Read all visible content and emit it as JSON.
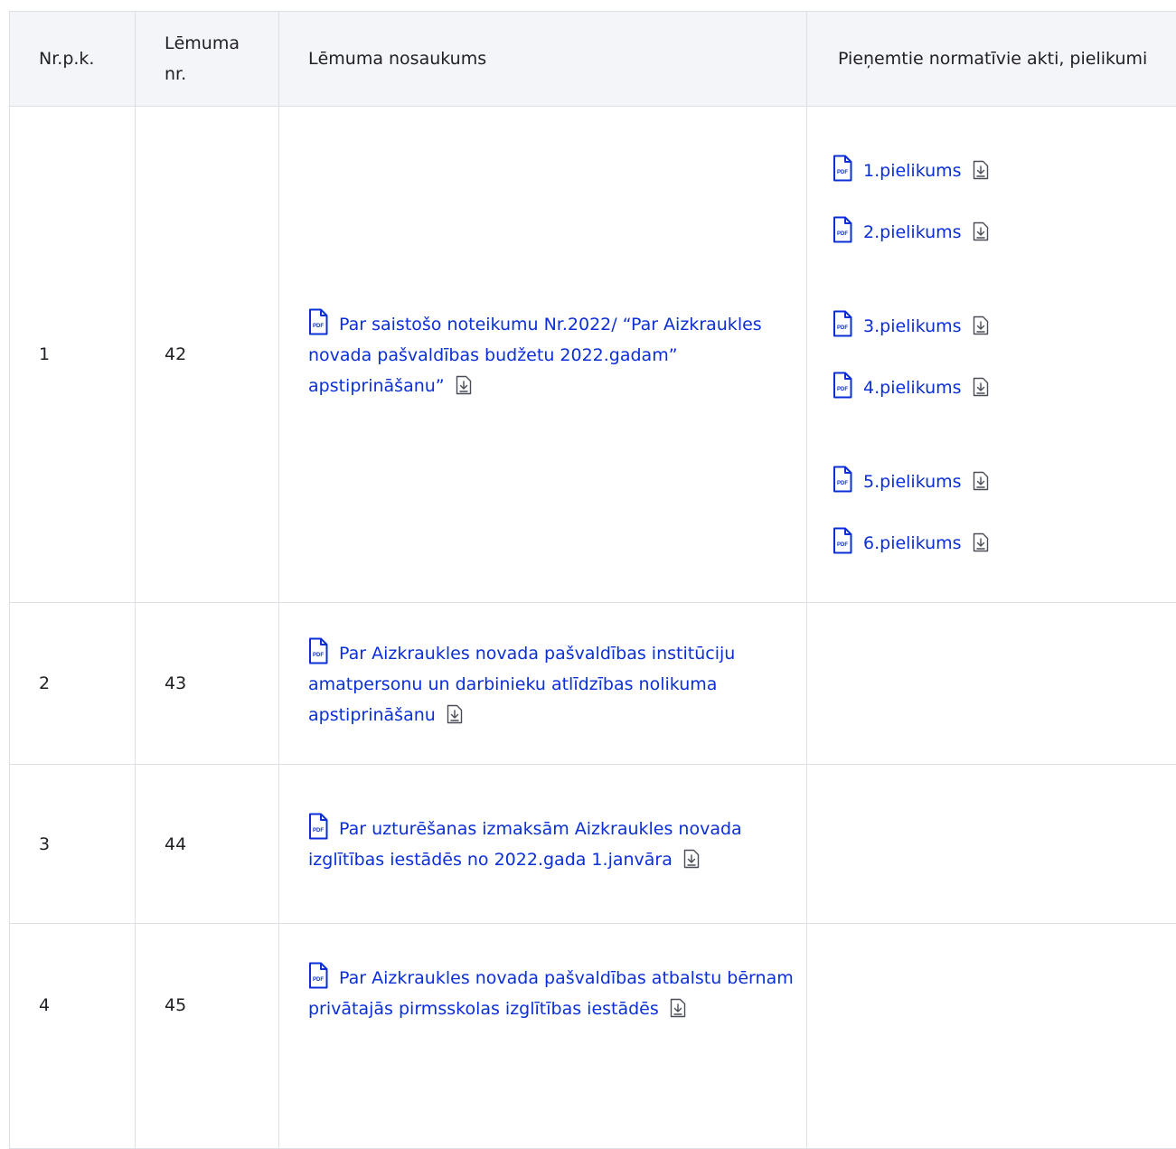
{
  "headers": {
    "nr": "Nr.p.k.",
    "decision_no": "Lēmuma nr.",
    "decision_title": "Lēmuma nosaukums",
    "attachments": "Pieņemtie normatīvie akti, pielikumi"
  },
  "rows": [
    {
      "nr": "1",
      "decision_no": "42",
      "title": "Par saistošo noteikumu Nr.2022/ “Par Aizkraukles novada pašvaldības budžetu 2022.gadam” apstiprināšanu”",
      "attachments": [
        "1.pielikums",
        "2.pielikums",
        "3.pielikums",
        "4.pielikums",
        "5.pielikums",
        "6.pielikums"
      ]
    },
    {
      "nr": "2",
      "decision_no": "43",
      "title": "Par Aizkraukles novada pašvaldības institūciju amatpersonu un darbinieku atlīdzības nolikuma apstiprināšanu"
    },
    {
      "nr": "3",
      "decision_no": "44",
      "title": "Par uzturēšanas izmaksām Aizkraukles novada izglītības iestādēs no 2022.gada 1.janvāra"
    },
    {
      "nr": "4",
      "decision_no": "45",
      "title": "Par Aizkraukles novada pašvaldības atbalstu bērnam privātajās pirmsskolas izglītības iestādēs"
    }
  ],
  "colors": {
    "link": "#0b2fd6",
    "header_bg": "#f4f5f8",
    "border": "#dcdfe6"
  },
  "icons": {
    "document": "pdf-file-icon",
    "download": "download-icon"
  }
}
